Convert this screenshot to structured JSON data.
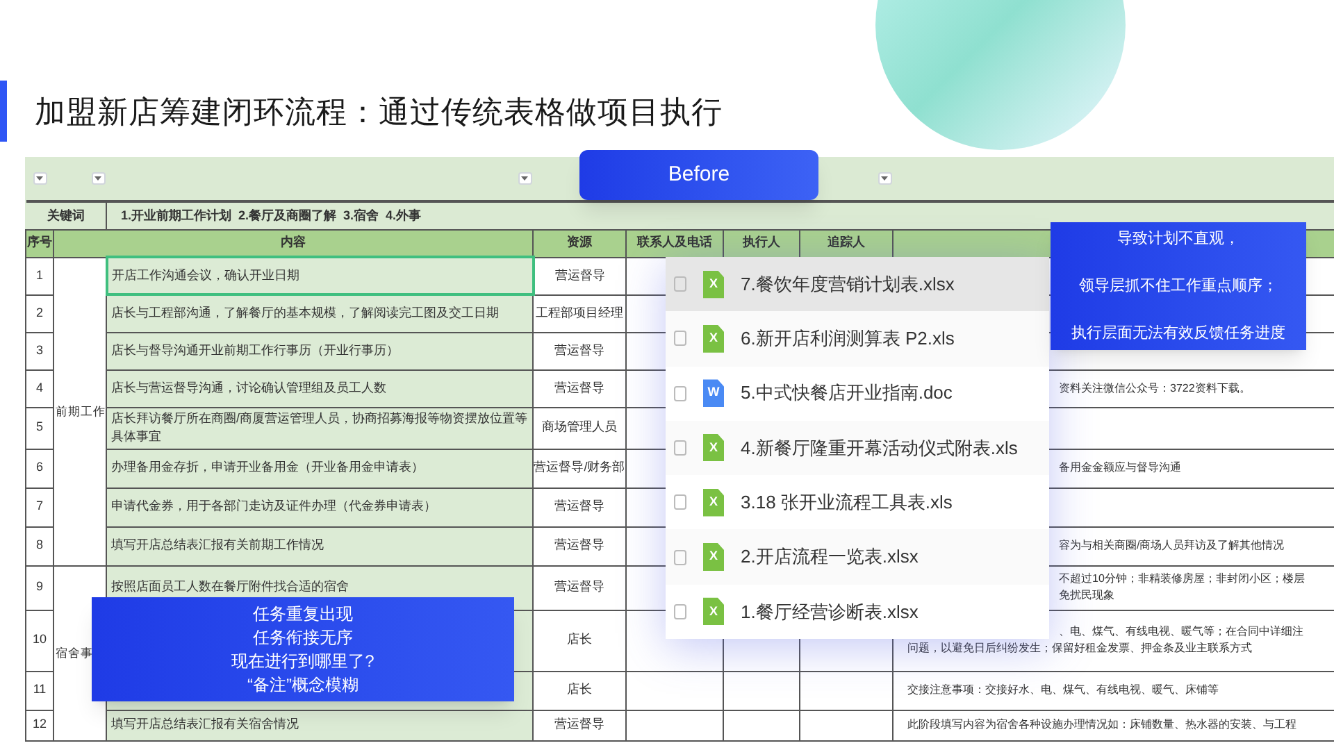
{
  "title": "加盟新店筹建闭环流程：通过传统表格做项目执行",
  "badge": "Before",
  "sheet": {
    "keyword_label": "关键词",
    "keywords": "1.开业前期工作计划  2.餐厅及商圈了解  3.宿舍  4.外事",
    "columns": [
      "序号",
      "内容",
      "资源",
      "联系人及电话",
      "执行人",
      "追踪人"
    ],
    "groups": [
      {
        "category": "前期工作",
        "rows": [
          {
            "no": "1",
            "content": "开店工作沟通会议，确认开业日期",
            "resource": "营运督导",
            "selected": true
          },
          {
            "no": "2",
            "content": "店长与工程部沟通，了解餐厅的基本规模，了解阅读完工图及交工日期",
            "resource": "工程部项目经理",
            "selected": false
          },
          {
            "no": "3",
            "content": "店长与督导沟通开业前期工作行事历（开业行事历）",
            "resource": "营运督导",
            "selected": false
          },
          {
            "no": "4",
            "content": "店长与营运督导沟通，讨论确认管理组及员工人数",
            "resource": "营运督导",
            "remark_lines": [
              "资料关注微信公众号：3722资料下载。"
            ],
            "selected": false
          },
          {
            "no": "5",
            "content": "店长拜访餐厅所在商圈/商厦营运管理人员，协商招募海报等物资摆放位置等具体事宜",
            "resource": "商场管理人员",
            "selected": false
          },
          {
            "no": "6",
            "content": "办理备用金存折，申请开业备用金（开业备用金申请表）",
            "resource": "营运督导/财务部",
            "remark_lines": [
              "备用金金额应与督导沟通"
            ],
            "selected": false
          },
          {
            "no": "7",
            "content": "申请代金券，用于各部门走访及证件办理（代金券申请表）",
            "resource": "营运督导",
            "selected": false
          },
          {
            "no": "8",
            "content": "填写开店总结表汇报有关前期工作情况",
            "resource": "营运督导",
            "remark_lines": [
              "容为与相关商圈/商场人员拜访及了解其他情况"
            ],
            "selected": false
          }
        ]
      },
      {
        "category": "宿舍事",
        "rows": [
          {
            "no": "9",
            "content": "按照店面员工人数在餐厅附件找合适的宿舍",
            "resource": "营运督导",
            "remark_lines": [
              "不超过10分钟；非精装修房屋；非封闭小区；楼层",
              "免扰民现象"
            ],
            "selected": false
          },
          {
            "no": "10",
            "resource": "店长",
            "remark_lines": [
              "、电、煤气、有线电视、暖气等；在合同中详细注",
              "问题，以避免日后纠纷发生；保留好租金发票、押金条及业主联系方式"
            ],
            "selected": false
          },
          {
            "no": "11",
            "resource": "店长",
            "remark_lines": [
              "交接注意事项：交接好水、电、煤气、有线电视、暖气、床铺等"
            ],
            "selected": false
          },
          {
            "no": "12",
            "content": "填写开店总结表汇报有关宿舍情况",
            "resource": "营运督导",
            "remark_lines": [
              "此阶段填写内容为宿舍各种设施办理情况如：床铺数量、热水器的安装、与工程"
            ],
            "selected": false
          }
        ]
      }
    ]
  },
  "files": [
    {
      "kind": "excel",
      "icon_text": "X",
      "name": "7.餐饮年度营销计划表.xlsx",
      "selected": true
    },
    {
      "kind": "excel",
      "icon_text": "X",
      "name": "6.新开店利润测算表 P2.xls",
      "selected": false
    },
    {
      "kind": "word",
      "icon_text": "W",
      "name": "5.中式快餐店开业指南.doc",
      "selected": false
    },
    {
      "kind": "excel",
      "icon_text": "X",
      "name": "4.新餐厅隆重开幕活动仪式附表.xls",
      "selected": false
    },
    {
      "kind": "excel",
      "icon_text": "X",
      "name": "3.18 张开业流程工具表.xls",
      "selected": false
    },
    {
      "kind": "excel",
      "icon_text": "X",
      "name": "2.开店流程一览表.xlsx",
      "selected": false
    },
    {
      "kind": "excel",
      "icon_text": "X",
      "name": "1.餐厅经营诊断表.xlsx",
      "selected": false
    }
  ],
  "callouts": [
    {
      "lines": [
        "导致计划不直观，",
        "领导层抓不住工作重点顺序；",
        "执行层面无法有效反馈任务进度"
      ]
    },
    {
      "lines": [
        "任务重复出现",
        "任务衔接无序",
        "现在进行到哪里了?",
        "“备注”概念模糊"
      ]
    }
  ]
}
